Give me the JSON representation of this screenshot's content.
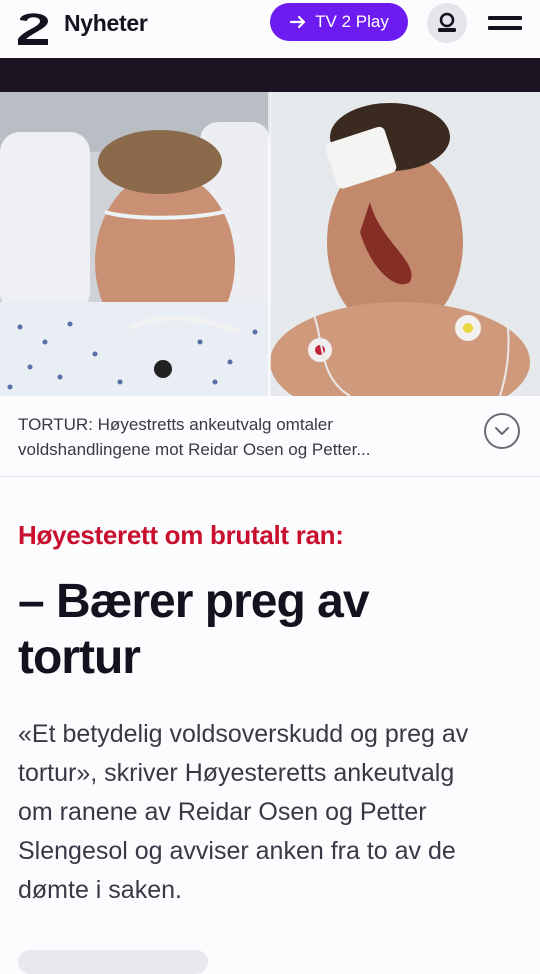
{
  "header": {
    "brand": "Nyheter",
    "logo_icon": "tv2-logo-icon",
    "play_button_label": "TV 2 Play",
    "play_icon": "arrow-right-icon",
    "profile_icon": "user-icon",
    "menu_icon": "hamburger-menu-icon",
    "accent_color": "#6c1cf0"
  },
  "photo": {
    "caption_line1": "TORTUR: Høyestretts ankeutvalg omtaler",
    "caption_line2": "voldshandlingene mot Reidar Osen og Petter...",
    "expand_icon": "chevron-down-icon"
  },
  "article": {
    "kicker": "Høyesterett om brutalt ran:",
    "kicker_color": "#c8102e",
    "headline_line1": "– Bærer preg av",
    "headline_line2": "tortur",
    "lead_lines": [
      "«Et betydelig voldsoverskudd og preg av",
      "tortur», skriver Høyesteretts ankeutvalg",
      "om ranene av Reidar Osen og Petter",
      "Slengesol og avviser anken fra to av de",
      "dømte i saken."
    ]
  }
}
